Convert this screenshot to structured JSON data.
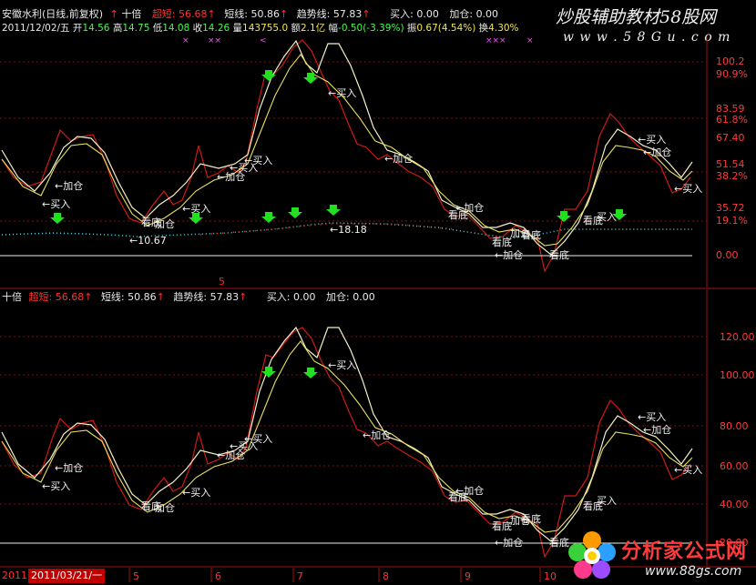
{
  "header": {
    "title": "安徽水利(日线,前复权)",
    "arrow": "↑",
    "indicator_name": "十倍",
    "chaoduan_label": "超短:",
    "chaoduan_value": "56.68",
    "duanxian_label": "短线:",
    "duanxian_value": "50.86",
    "qushi_label": "趋势线:",
    "qushi_value": "57.83",
    "buy_label": "买入:",
    "buy_value": "0.00",
    "addpos_label": "加仓:",
    "addpos_value": "0.00"
  },
  "quote": {
    "date": "2011/12/02/五",
    "open_label": "开",
    "open": "14.56",
    "high_label": "高",
    "high": "14.75",
    "low_label": "低",
    "low": "14.08",
    "close_label": "收",
    "close": "14.26",
    "vol_label": "量",
    "vol": "143755.0",
    "amt_label": "额",
    "amt": "2.1亿",
    "chg_label": "幅",
    "chg": "-0.50(-3.39%)",
    "amp_label": "振",
    "amp": "0.67(4.54%)",
    "turn_label": "换",
    "turn": "4.30%"
  },
  "watermark": {
    "top": "炒股辅助教材58股网",
    "top_url": "w w w . 5 8 G u . c o m",
    "bottom": "分析家公式网",
    "bottom_url": "www.88gs.com"
  },
  "upper_panel": {
    "axis_labels": [
      "100.2",
      "90.9%",
      "83.59",
      "61.8%",
      "67.40",
      "51.54",
      "38.2%",
      "35.72",
      "19.1%",
      "0.00"
    ],
    "price_low": "10.67",
    "price_high": "18.18",
    "tags": {
      "add": "加仓",
      "buy": "买入",
      "bottom": "看底",
      "add_arrow": "←加仓",
      "buy_arrow": "←买入"
    }
  },
  "lower_panel": {
    "title": "十倍",
    "arrow": "↑",
    "chaoduan_label": "超短:",
    "chaoduan_value": "56.68",
    "duanxian_label": "短线:",
    "duanxian_value": "50.86",
    "qushi_label": "趋势线:",
    "qushi_value": "57.83",
    "buy_label": "买入:",
    "buy_value": "0.00",
    "addpos_label": "加仓:",
    "addpos_value": "0.00",
    "axis_labels": [
      "120.00",
      "100.00",
      "80.00",
      "60.00",
      "40.00",
      "20.00"
    ]
  },
  "date_axis": {
    "prefix": "2011",
    "cursor_date": "2011/03/21/一",
    "months": [
      "5",
      "6",
      "7",
      "8",
      "9",
      "10"
    ],
    "top_marker": "5"
  },
  "colors": {
    "background": "#000000",
    "line_white": "#f0f0c8",
    "line_yellow": "#e8e060",
    "line_red": "#d01818",
    "axis_red": "#a01010",
    "buy_arrow_green": "#20e020",
    "dot_cyan": "#40e0e0"
  }
}
